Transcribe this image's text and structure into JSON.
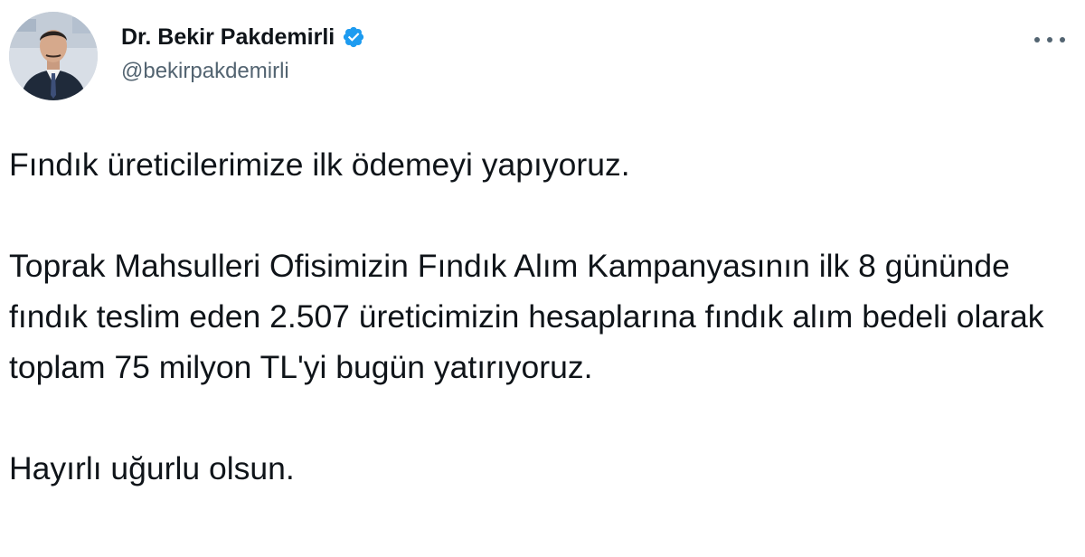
{
  "author": {
    "display_name": "Dr. Bekir Pakdemirli",
    "handle": "@bekirpakdemirli",
    "verified": true
  },
  "menu": {
    "icon": "more-horizontal-icon"
  },
  "tweet": {
    "paragraph_1": "Fındık üreticilerimize ilk ödemeyi yapıyoruz.",
    "paragraph_2": "Toprak Mahsulleri Ofisimizin Fındık Alım Kampanyasının ilk 8 gününde fındık teslim eden 2.507 üreticimizin hesaplarına fındık alım bedeli olarak toplam 75 milyon TL'yi bugün yatırıyoruz.",
    "paragraph_3": "Hayırlı uğurlu olsun."
  },
  "colors": {
    "text": "#0f1419",
    "secondary_text": "#536471",
    "verified_badge": "#1d9bf0",
    "background": "#ffffff"
  }
}
